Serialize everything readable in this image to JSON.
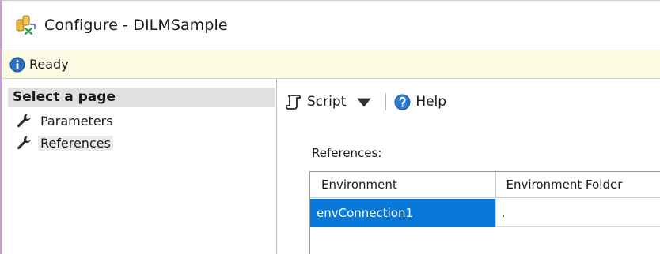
{
  "window": {
    "title": "Configure - DILMSample",
    "icon": "ssis-project-icon"
  },
  "status": {
    "icon": "info-icon",
    "text": "Ready"
  },
  "sidebar": {
    "header": "Select a page",
    "items": [
      {
        "label": "Parameters",
        "icon": "wrench-icon",
        "selected": false
      },
      {
        "label": "References",
        "icon": "wrench-icon",
        "selected": true
      }
    ]
  },
  "toolbar": {
    "script_label": "Script",
    "help_label": "Help"
  },
  "references": {
    "label": "References:",
    "columns": [
      "Environment",
      "Environment Folder"
    ],
    "rows": [
      {
        "environment": "envConnection1",
        "folder": "."
      }
    ]
  },
  "colors": {
    "status_bg": "#fbfbe4",
    "selection": "#0a78d8",
    "header_bg": "#e0e0e0",
    "window_border": "#c79cd8"
  }
}
